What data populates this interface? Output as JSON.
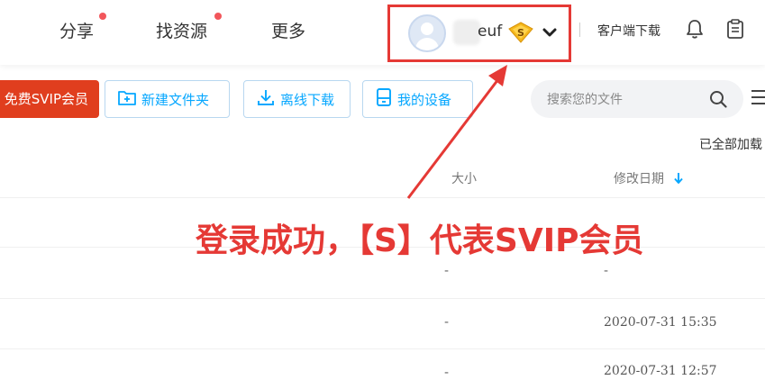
{
  "nav": {
    "items": [
      {
        "label": "分享",
        "has_dot": true
      },
      {
        "label": "找资源",
        "has_dot": true
      },
      {
        "label": "更多",
        "has_dot": false
      }
    ]
  },
  "user": {
    "name_suffix": "euf",
    "badge_letter": "S",
    "badge_color": "#f5b81c"
  },
  "header_links": {
    "client_download": "客户端下载"
  },
  "toolbar": {
    "svip_button": "免费SVIP会员",
    "new_folder": "新建文件夹",
    "offline_download": "离线下载",
    "my_devices": "我的设备"
  },
  "search": {
    "placeholder": "搜索您的文件"
  },
  "status": {
    "loaded_all": "已全部加载"
  },
  "table": {
    "columns": {
      "size": "大小",
      "modified": "修改日期"
    },
    "rows": [
      {
        "size": "-",
        "modified": "-"
      },
      {
        "size": "-",
        "modified": "2020-07-31 15:35"
      },
      {
        "size": "-",
        "modified": "2020-07-31 12:57"
      }
    ]
  },
  "annotation": {
    "text": "登录成功，【S】代表SVIP会员",
    "color": "#e53935"
  },
  "colors": {
    "accent": "#06a7ff",
    "svip_button": "#e03e1e",
    "notify_dot": "#f2565b"
  }
}
